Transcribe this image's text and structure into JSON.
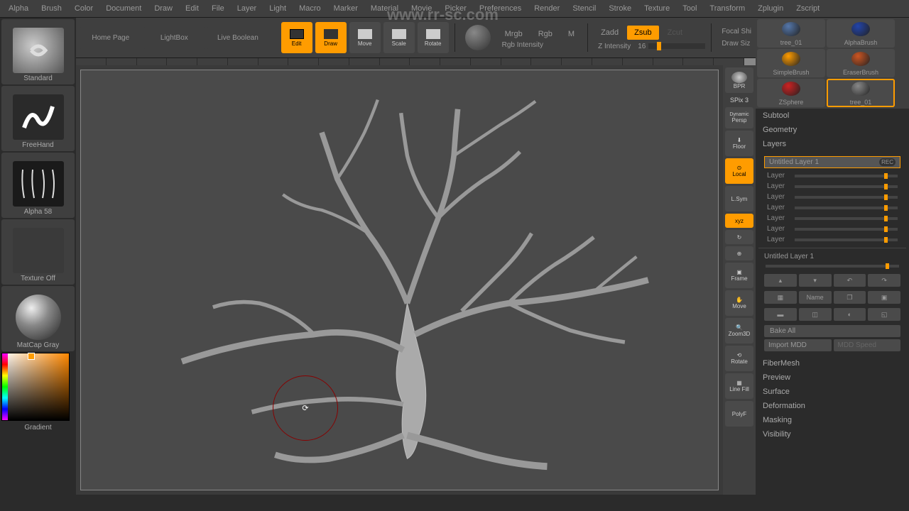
{
  "menu": [
    "Alpha",
    "Brush",
    "Color",
    "Document",
    "Draw",
    "Edit",
    "File",
    "Layer",
    "Light",
    "Macro",
    "Marker",
    "Material",
    "Movie",
    "Picker",
    "Preferences",
    "Render",
    "Stencil",
    "Stroke",
    "Texture",
    "Tool",
    "Transform",
    "Zplugin",
    "Zscript"
  ],
  "watermark_url": "www.rr-sc.com",
  "left_tabs": {
    "home": "Home Page",
    "lightbox": "LightBox",
    "liveboolean": "Live Boolean"
  },
  "left_tools": {
    "brush": "Standard",
    "stroke": "FreeHand",
    "alpha": "Alpha 58",
    "texture": "Texture Off",
    "material": "MatCap Gray",
    "gradient": "Gradient"
  },
  "toolbar": {
    "edit": "Edit",
    "draw": "Draw",
    "move": "Move",
    "scale": "Scale",
    "rotate": "Rotate",
    "modes": {
      "mrgb": "Mrgb",
      "rgb": "Rgb",
      "m": "M"
    },
    "zmodes": {
      "zadd": "Zadd",
      "zsub": "Zsub",
      "zcut": "Zcut"
    },
    "rgb_intensity": "Rgb Intensity",
    "z_intensity_label": "Z Intensity",
    "z_intensity_value": "16",
    "focal": "Focal Shi",
    "drawsize": "Draw Siz"
  },
  "view_tools": {
    "bpr": "BPR",
    "spix_label": "SPix",
    "spix_value": "3",
    "dynamic": "Dynamic",
    "persp": "Persp",
    "floor": "Floor",
    "local": "Local",
    "lsym": "L.Sym",
    "xyz": "xyz",
    "frame": "Frame",
    "move": "Move",
    "zoom3d": "Zoom3D",
    "rotate": "Rotate",
    "linefill": "Line Fill",
    "polyf": "PolyF"
  },
  "right": {
    "thumbs": [
      {
        "label": "tree_01",
        "color": "#5577aa"
      },
      {
        "label": "AlphaBrush",
        "color": "#2244aa"
      },
      {
        "label": "SimpleBrush",
        "color": "#ff9c00"
      },
      {
        "label": "EraserBrush",
        "color": "#cc5522"
      },
      {
        "label": "ZSphere",
        "color": "#cc2222"
      },
      {
        "label": "tree_01",
        "color": "#888",
        "active": true
      }
    ],
    "sections_top": [
      "Subtool",
      "Geometry",
      "Layers"
    ],
    "active_layer": "Untitled Layer",
    "active_layer_num": "1",
    "rec": "REC",
    "layer_generic": "Layer",
    "layer_rows": 7,
    "untitled_layer": "Untitled Layer",
    "untitled_num": "1",
    "btn_name": "Name",
    "bake_all": "Bake All",
    "import_mdd": "Import MDD",
    "mdd_speed": "MDD Speed",
    "sections_bottom": [
      "FiberMesh",
      "Preview",
      "Surface",
      "Deformation",
      "Masking",
      "Visibility"
    ]
  }
}
